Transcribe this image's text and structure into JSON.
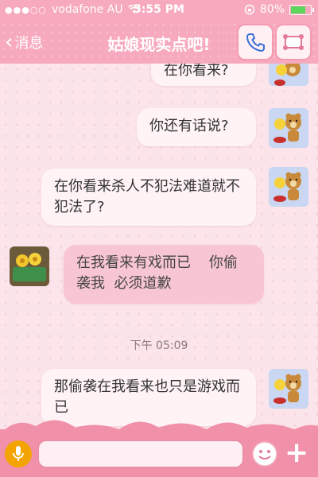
{
  "status_bar": {
    "signal_dots": "●●●○○",
    "carrier": "vodafone AU",
    "time": "5:55 PM",
    "battery": "80%",
    "battery_level": 0.8
  },
  "nav": {
    "back_label": "消息",
    "title": "姑娘现实点吧!",
    "phone_icon": "phone-icon",
    "profile_icon": "profile-icon"
  },
  "messages": [
    {
      "direction": "out",
      "text": "在你看来?"
    },
    {
      "direction": "out",
      "text": "你还有话说?"
    },
    {
      "direction": "out",
      "text": "在你看来杀人不犯法难道就不犯法了?"
    },
    {
      "direction": "in",
      "text": "在我看来有戏而已    你偷袭我  必须道歉"
    },
    {
      "direction": "out",
      "text": "那偷袭在我看来也只是游戏而已"
    }
  ],
  "timestamp": "下午 05:09",
  "input_bar": {
    "placeholder": "",
    "mic_icon": "mic-icon",
    "emoji_icon": "emoji-icon",
    "plus_label": "+"
  },
  "colors": {
    "nav_pink": "#f7a9bd",
    "bubble_out": "#fff3f6",
    "bubble_in": "#f8c6d2",
    "mic_orange": "#f4a400"
  }
}
